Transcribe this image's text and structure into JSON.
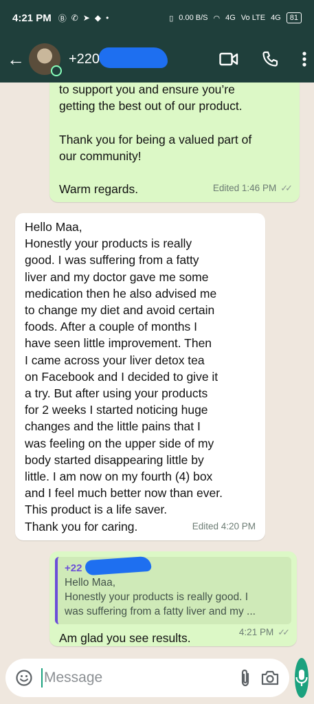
{
  "status_bar": {
    "time": "4:21 PM",
    "left_icons": [
      "b-icon",
      "whatsapp-icon",
      "telegram-icon",
      "bubble-icon",
      "dot-icon"
    ],
    "network_speed": "0.00 B/S",
    "signal_1": "4G",
    "volte": "Vo LTE",
    "signal_2": "4G",
    "battery": "81"
  },
  "header": {
    "contact_name": "+220 7",
    "actions": [
      "video-call-icon",
      "voice-call-icon",
      "more-options-icon"
    ]
  },
  "messages": [
    {
      "direction": "out",
      "text": "to support you and ensure you’re\ngetting the best out of our product.\n\nThank you for being a valued part of\nour community!\n\nWarm regards.",
      "meta": "Edited 1:46 PM",
      "ticks": "✓✓"
    },
    {
      "direction": "in",
      "text": "Hello Maa,\nHonestly your products is really\ngood. I was suffering  from a fatty\nliver and my doctor gave me some\nmedication then he also advised me\nto change my diet and avoid certain\nfoods.    After a couple of months I\nhave seen little improvement. Then\nI came across your liver detox tea\non Facebook and I decided to give it\na try. But after using your products\nfor 2 weeks I started noticing huge\nchanges and the little pains that I\nwas feeling on the upper side of my\nbody started disappearing little by\nlittle. I am now on my fourth (4) box\nand I feel much better now than ever.\nThis product is a life saver.\nThank you for caring.",
      "meta": "Edited 4:20 PM"
    },
    {
      "direction": "out",
      "quote_name": "+22",
      "quote_text": "Hello Maa,\nHonestly your products is really good. I\nwas suffering  from a fatty liver and my ...",
      "text": "Am glad you see results.",
      "meta": "4:21 PM",
      "ticks": "✓✓"
    }
  ],
  "input": {
    "placeholder": "Message"
  },
  "colors": {
    "header": "#1f3f3b",
    "outgoing_bubble": "#dcf8c6",
    "incoming_bubble": "#ffffff",
    "accent": "#1aa17e",
    "background": "#efe7de"
  }
}
